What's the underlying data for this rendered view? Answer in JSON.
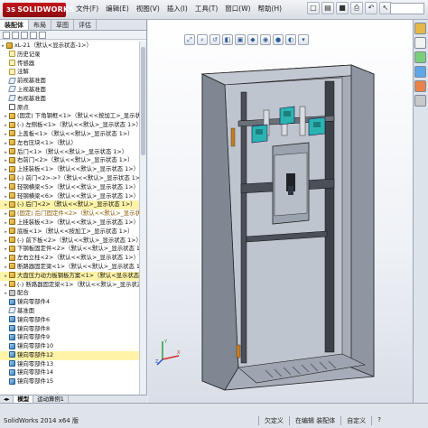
{
  "app": {
    "logo_text": "SOLIDWORKS",
    "logo_prefix": "3S"
  },
  "menu": [
    "文件(F)",
    "编辑(E)",
    "视图(V)",
    "插入(I)",
    "工具(T)",
    "窗口(W)",
    "帮助(H)"
  ],
  "panel_tabs": [
    "装配体",
    "布局",
    "草图",
    "评估"
  ],
  "tree": [
    {
      "label": "xL-21（默认<显示状态-1>）",
      "icon": "assembly",
      "expanded": true
    },
    {
      "label": "历史记录",
      "icon": "folder"
    },
    {
      "label": "传感器",
      "icon": "folder"
    },
    {
      "label": "注解",
      "icon": "folder"
    },
    {
      "label": "前视基准面",
      "icon": "plane"
    },
    {
      "label": "上视基准面",
      "icon": "plane"
    },
    {
      "label": "右视基准面",
      "icon": "plane"
    },
    {
      "label": "原点",
      "icon": "origin"
    },
    {
      "label": "(固定) 下角钢框<1>（默认<<按加工>_显示状态 1>）",
      "icon": "part"
    },
    {
      "label": "(-) 左侧板<1>（默认<<默认>_显示状态 1>）",
      "icon": "part"
    },
    {
      "label": "上盖板<1>（默认<<默认>_显示状态 1>）",
      "icon": "part"
    },
    {
      "label": "左右压块<1>（默认）",
      "icon": "part"
    },
    {
      "label": "后门<1>（默认<<默认>_显示状态 1>）",
      "icon": "part"
    },
    {
      "label": "右前门<2>（默认<<默认>_显示状态 1>）",
      "icon": "part"
    },
    {
      "label": "上挂装板<1>（默认<<默认>_显示状态 1>）",
      "icon": "part"
    },
    {
      "label": "(-) 前门<2>->?（默认<<默认>_显示状态 1>）",
      "icon": "part"
    },
    {
      "label": "轻钢横梁<5>（默认<<默认>_显示状态 1>）",
      "icon": "part"
    },
    {
      "label": "轻钢横梁<6>（默认<<默认>_显示状态 1>）",
      "icon": "part"
    },
    {
      "label": "(-) 后门<2>（默认<<默认>_显示状态 1>）",
      "icon": "part",
      "highlight": true
    },
    {
      "label": "(固定) 后门固定件<2>（默认<<默认>_显示状态 1>）",
      "icon": "part",
      "selected": true
    },
    {
      "label": "上挂装板<3>（默认<<默认>_显示状态 1>）",
      "icon": "part"
    },
    {
      "label": "底板<1>（默认<<按加工>_显示状态 1>）",
      "icon": "part"
    },
    {
      "label": "(-) 前下板<2>（默认<<默认>_显示状态 1>）",
      "icon": "part"
    },
    {
      "label": "下钢板固定件<2>（默认<<默认>_显示状态 1>）",
      "icon": "part"
    },
    {
      "label": "左右立柱<2>（默认<<默认>_显示状态 1>）",
      "icon": "part"
    },
    {
      "label": "断路器固定梁<1>（默认<<默认>_显示状态 1>）",
      "icon": "part"
    },
    {
      "label": "大盘压力动力板钢板方案<1>（默认<显示状态 1>）",
      "icon": "part",
      "highlight": true
    },
    {
      "label": "(-) 断路器固定梁<1>（默认<<默认>_显示状态 1>）",
      "icon": "part"
    },
    {
      "label": "配合",
      "icon": "mate"
    },
    {
      "label": "镜向零部件4",
      "icon": "mirror"
    },
    {
      "label": "基准面",
      "icon": "plane"
    },
    {
      "label": "镜向零部件6",
      "icon": "mirror"
    },
    {
      "label": "镜向零部件8",
      "icon": "mirror"
    },
    {
      "label": "镜向零部件9",
      "icon": "mirror"
    },
    {
      "label": "镜向零部件10",
      "icon": "mirror"
    },
    {
      "label": "镜向零部件12",
      "icon": "mirror",
      "highlight": true
    },
    {
      "label": "镜向零部件13",
      "icon": "mirror"
    },
    {
      "label": "镜向零部件14",
      "icon": "mirror"
    },
    {
      "label": "镜向零部件15",
      "icon": "mirror"
    }
  ],
  "bottom_tabs": [
    "模型",
    "运动算例1"
  ],
  "status": {
    "app_version": "SolidWorks 2014 x64 版",
    "fields": [
      "欠定义",
      "在编辑 装配体",
      "自定义",
      "?"
    ]
  },
  "colors": {
    "accent": "#c4161c",
    "highlight_row": "#fff3a8",
    "cabinet": "#9aa2ad",
    "device_teal": "#2bb3b1"
  }
}
